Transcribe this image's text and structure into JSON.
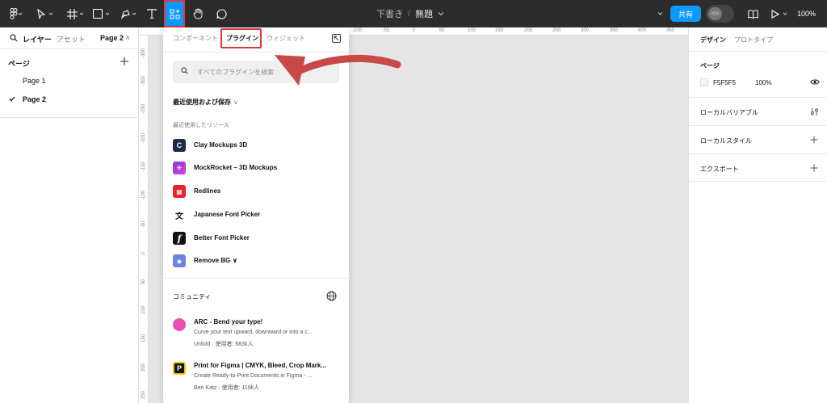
{
  "toolbar": {
    "doc_folder": "下書き",
    "doc_separator": "/",
    "doc_name": "無題",
    "share_label": "共有",
    "zoom": "100%"
  },
  "left_panel": {
    "tab_layers": "レイヤー",
    "tab_assets": "アセット",
    "page_select": "Page 2",
    "pages_title": "ページ",
    "pages": [
      {
        "label": "Page 1",
        "selected": false
      },
      {
        "label": "Page 2",
        "selected": true
      }
    ]
  },
  "ruler": {
    "top": [
      "-100",
      "-50",
      "0",
      "50",
      "100",
      "150",
      "200",
      "250",
      "300",
      "350",
      "400",
      "450"
    ],
    "left": [
      "-350",
      "-300",
      "-250",
      "-200",
      "-150",
      "-100",
      "-50",
      "0",
      "50",
      "100",
      "150",
      "200",
      "250"
    ]
  },
  "resources": {
    "tabs": {
      "components": "コンポーネント",
      "plugins": "プラグイン",
      "widgets": "ウィジェット"
    },
    "search_placeholder": "すべてのプラグインを検索",
    "recent_saved": "最近使用および保存",
    "recent_title": "最近使用したリソース",
    "plugins": [
      {
        "label": "Clay Mockups 3D",
        "icon": "C",
        "color": "#1f2a44"
      },
      {
        "label": "MockRocket – 3D Mockups",
        "icon": "✈",
        "color": "#c03ad8"
      },
      {
        "label": "Redlines",
        "icon": "▦",
        "color": "#e8232e"
      },
      {
        "label": "Japanese Font Picker",
        "icon": "文",
        "color": "#ffffff"
      },
      {
        "label": "Better Font Picker",
        "icon": "f",
        "color": "#111111"
      },
      {
        "label": "Remove BG",
        "icon": "◆",
        "color": "#6b84e6"
      }
    ],
    "community_title": "コミュニティ",
    "community": [
      {
        "title": "ARC - Bend your type!",
        "desc": "Curve your text upward, downward or into a c...",
        "meta": "Unfold · 使用者: 683k人",
        "color": "#e84fb0"
      },
      {
        "title": "Print for Figma | CMYK, Bleed, Crop Mark...",
        "desc": "Create Ready-to-Print Documents in Figma - ...",
        "meta": "Ben Katz · 使用者: 119k人",
        "color": "#111111"
      }
    ]
  },
  "right_panel": {
    "tab_design": "デザイン",
    "tab_prototype": "プロトタイプ",
    "page_title": "ページ",
    "bg_color": "F5F5F5",
    "bg_opacity": "100%",
    "sections": [
      "ローカルバリアブル",
      "ローカルスタイル",
      "エクスポート"
    ]
  },
  "colors": {
    "accent": "#0d99ff",
    "annotation": "#c94848"
  }
}
